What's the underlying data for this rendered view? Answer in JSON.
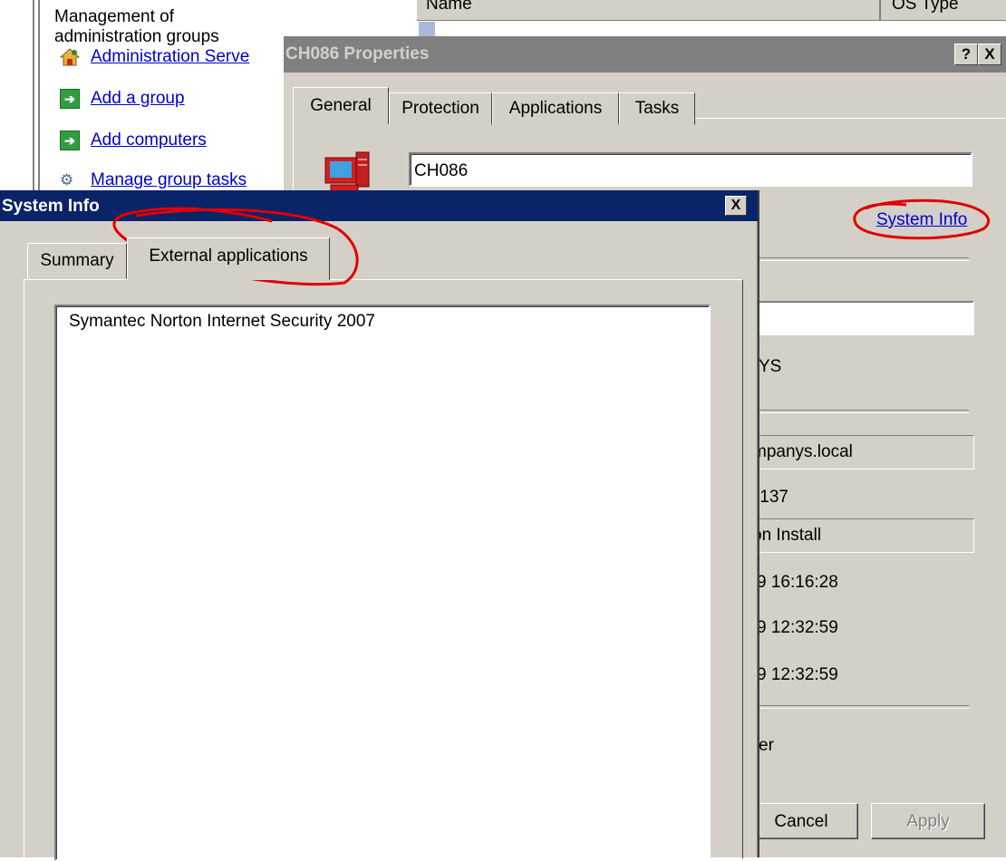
{
  "console": {
    "header": "Management of administration groups",
    "tasks": [
      {
        "label": "Administration Serve",
        "icon": "house-icon"
      },
      {
        "label": "Add a group",
        "icon": "green-arrow-icon"
      },
      {
        "label": "Add computers",
        "icon": "green-arrow-icon"
      },
      {
        "label": "Manage group tasks",
        "icon": "gear-icon"
      }
    ],
    "list_columns": [
      "Name",
      "OS Type"
    ]
  },
  "properties_dialog": {
    "title": "CH086 Properties",
    "help_button": "?",
    "close_button": "X",
    "tabs": [
      "General",
      "Protection",
      "Applications",
      "Tasks"
    ],
    "active_tab": "General",
    "computer_name": "CH086",
    "system_info_link": "System Info",
    "visible_fragments": {
      "ys": "YS",
      "domain": "mpanys.local",
      "ip": ".137",
      "status": "on Install",
      "time1": "9 16:16:28",
      "time2": "9 12:32:59",
      "time3": "9 12:32:59",
      "er": "er"
    },
    "buttons": {
      "cancel": "Cancel",
      "apply": "Apply"
    }
  },
  "system_info_dialog": {
    "title": "System Info",
    "close_button": "X",
    "tabs": [
      "Summary",
      "External applications"
    ],
    "active_tab": "External applications",
    "applications": [
      "Symantec Norton Internet Security 2007"
    ]
  },
  "annotation_color": "#e00000",
  "title_active_color": "#0a246a",
  "title_inactive_color": "#808080"
}
